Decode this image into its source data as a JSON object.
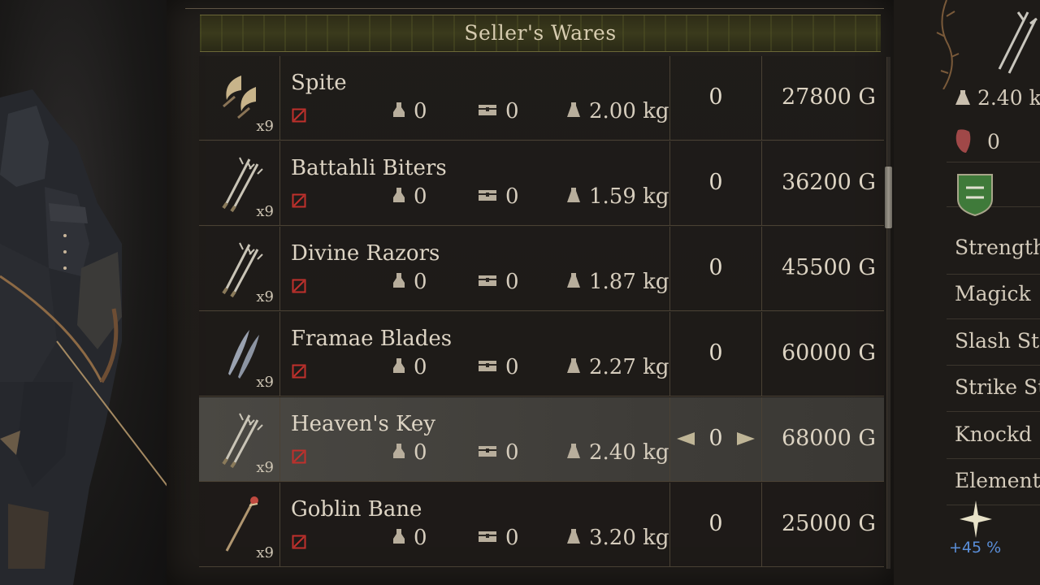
{
  "shop": {
    "title": "Seller's Wares",
    "items": [
      {
        "name": "Spite",
        "owned": "x9",
        "stat1": "0",
        "stat2": "0",
        "weight": "2.00 kg",
        "count": "0",
        "price": "27800 G",
        "icon": "crescent-daggers-icon"
      },
      {
        "name": "Battahli Biters",
        "owned": "x9",
        "stat1": "0",
        "stat2": "0",
        "weight": "1.59 kg",
        "count": "0",
        "price": "36200 G",
        "icon": "trident-daggers-icon"
      },
      {
        "name": "Divine Razors",
        "owned": "x9",
        "stat1": "0",
        "stat2": "0",
        "weight": "1.87 kg",
        "count": "0",
        "price": "45500 G",
        "icon": "trident-daggers-icon"
      },
      {
        "name": "Framae Blades",
        "owned": "x9",
        "stat1": "0",
        "stat2": "0",
        "weight": "2.27 kg",
        "count": "0",
        "price": "60000 G",
        "icon": "leaf-blades-icon"
      },
      {
        "name": "Heaven's Key",
        "owned": "x9",
        "stat1": "0",
        "stat2": "0",
        "weight": "2.40 kg",
        "count": "0",
        "price": "68000 G",
        "icon": "trident-daggers-icon",
        "selected": true
      },
      {
        "name": "Goblin Bane",
        "owned": "x9",
        "stat1": "0",
        "stat2": "0",
        "weight": "3.20 kg",
        "count": "0",
        "price": "25000 G",
        "icon": "staff-icon"
      }
    ]
  },
  "detail": {
    "weight": "2.40 kg",
    "defense": "0",
    "stats": [
      "Strength",
      "Magick",
      "Slash St",
      "Strike St",
      "Knockd",
      "Element"
    ],
    "element_pct": "+45 %"
  },
  "colors": {
    "header_olive": "#3a3a1c",
    "selected_row": "#4a4843",
    "noentry_red": "#c0302c",
    "element_blue": "#5a8ed8"
  }
}
